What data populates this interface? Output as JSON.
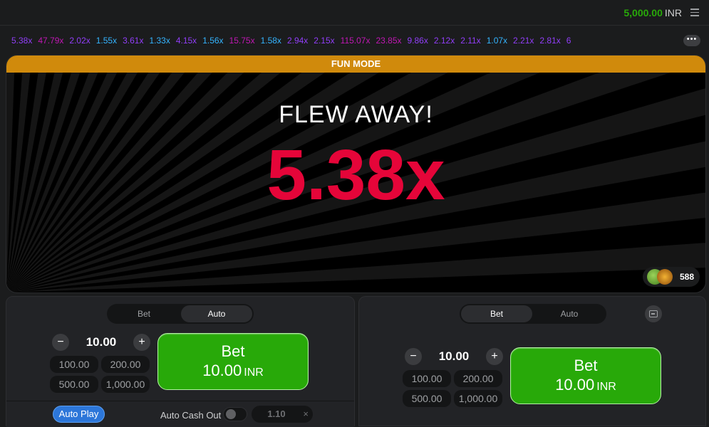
{
  "header": {
    "balance": "5,000.00",
    "currency": "INR",
    "menu_icon": "hamburger-menu-icon"
  },
  "history": {
    "multipliers": [
      {
        "value": "5.38x",
        "color": "purple"
      },
      {
        "value": "47.79x",
        "color": "pink"
      },
      {
        "value": "2.02x",
        "color": "purple"
      },
      {
        "value": "1.55x",
        "color": "blue"
      },
      {
        "value": "3.61x",
        "color": "purple"
      },
      {
        "value": "1.33x",
        "color": "blue"
      },
      {
        "value": "4.15x",
        "color": "purple"
      },
      {
        "value": "1.56x",
        "color": "blue"
      },
      {
        "value": "15.75x",
        "color": "pink"
      },
      {
        "value": "1.58x",
        "color": "blue"
      },
      {
        "value": "2.94x",
        "color": "purple"
      },
      {
        "value": "2.15x",
        "color": "purple"
      },
      {
        "value": "115.07x",
        "color": "pink"
      },
      {
        "value": "23.85x",
        "color": "pink"
      },
      {
        "value": "9.86x",
        "color": "purple"
      },
      {
        "value": "2.12x",
        "color": "purple"
      },
      {
        "value": "2.11x",
        "color": "purple"
      },
      {
        "value": "1.07x",
        "color": "blue"
      },
      {
        "value": "2.21x",
        "color": "purple"
      },
      {
        "value": "2.81x",
        "color": "purple"
      },
      {
        "value": "6",
        "color": "purple"
      }
    ],
    "more_label": "•••"
  },
  "stage": {
    "banner": "FUN MODE",
    "status": "FLEW AWAY!",
    "multiplier": "5.38x",
    "players_count": "588"
  },
  "panel_left": {
    "tabs": [
      "Bet",
      "Auto"
    ],
    "active_tab": "Auto",
    "amount": "10.00",
    "minus": "−",
    "plus": "+",
    "quick": [
      "100.00",
      "200.00",
      "500.00",
      "1,000.00"
    ],
    "bet_label": "Bet",
    "bet_amount": "10.00",
    "bet_currency": "INR",
    "autoplay_label": "Auto Play",
    "auto_cashout_label": "Auto Cash Out",
    "auto_cashout_value": "1.10",
    "clear": "×"
  },
  "panel_right": {
    "tabs": [
      "Bet",
      "Auto"
    ],
    "active_tab": "Bet",
    "amount": "10.00",
    "minus": "−",
    "plus": "+",
    "quick": [
      "100.00",
      "200.00",
      "500.00",
      "1,000.00"
    ],
    "bet_label": "Bet",
    "bet_amount": "10.00",
    "bet_currency": "INR",
    "remove_icon": "remove-panel-icon"
  },
  "colors": {
    "green": "#28a909",
    "red": "#e50539",
    "orange": "#d08a0c",
    "blue": "#34b4ff",
    "purple": "#913ef8",
    "pink": "#c017b4"
  }
}
